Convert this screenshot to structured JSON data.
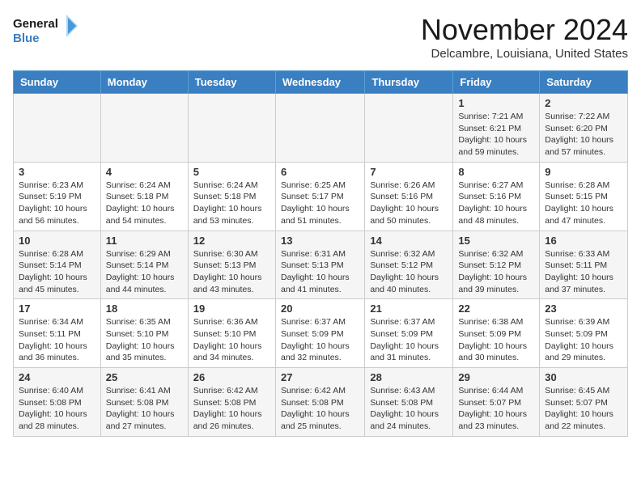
{
  "logo": {
    "line1": "General",
    "line2": "Blue"
  },
  "title": "November 2024",
  "location": "Delcambre, Louisiana, United States",
  "weekdays": [
    "Sunday",
    "Monday",
    "Tuesday",
    "Wednesday",
    "Thursday",
    "Friday",
    "Saturday"
  ],
  "weeks": [
    [
      {
        "day": "",
        "info": ""
      },
      {
        "day": "",
        "info": ""
      },
      {
        "day": "",
        "info": ""
      },
      {
        "day": "",
        "info": ""
      },
      {
        "day": "",
        "info": ""
      },
      {
        "day": "1",
        "info": "Sunrise: 7:21 AM\nSunset: 6:21 PM\nDaylight: 10 hours\nand 59 minutes."
      },
      {
        "day": "2",
        "info": "Sunrise: 7:22 AM\nSunset: 6:20 PM\nDaylight: 10 hours\nand 57 minutes."
      }
    ],
    [
      {
        "day": "3",
        "info": "Sunrise: 6:23 AM\nSunset: 5:19 PM\nDaylight: 10 hours\nand 56 minutes."
      },
      {
        "day": "4",
        "info": "Sunrise: 6:24 AM\nSunset: 5:18 PM\nDaylight: 10 hours\nand 54 minutes."
      },
      {
        "day": "5",
        "info": "Sunrise: 6:24 AM\nSunset: 5:18 PM\nDaylight: 10 hours\nand 53 minutes."
      },
      {
        "day": "6",
        "info": "Sunrise: 6:25 AM\nSunset: 5:17 PM\nDaylight: 10 hours\nand 51 minutes."
      },
      {
        "day": "7",
        "info": "Sunrise: 6:26 AM\nSunset: 5:16 PM\nDaylight: 10 hours\nand 50 minutes."
      },
      {
        "day": "8",
        "info": "Sunrise: 6:27 AM\nSunset: 5:16 PM\nDaylight: 10 hours\nand 48 minutes."
      },
      {
        "day": "9",
        "info": "Sunrise: 6:28 AM\nSunset: 5:15 PM\nDaylight: 10 hours\nand 47 minutes."
      }
    ],
    [
      {
        "day": "10",
        "info": "Sunrise: 6:28 AM\nSunset: 5:14 PM\nDaylight: 10 hours\nand 45 minutes."
      },
      {
        "day": "11",
        "info": "Sunrise: 6:29 AM\nSunset: 5:14 PM\nDaylight: 10 hours\nand 44 minutes."
      },
      {
        "day": "12",
        "info": "Sunrise: 6:30 AM\nSunset: 5:13 PM\nDaylight: 10 hours\nand 43 minutes."
      },
      {
        "day": "13",
        "info": "Sunrise: 6:31 AM\nSunset: 5:13 PM\nDaylight: 10 hours\nand 41 minutes."
      },
      {
        "day": "14",
        "info": "Sunrise: 6:32 AM\nSunset: 5:12 PM\nDaylight: 10 hours\nand 40 minutes."
      },
      {
        "day": "15",
        "info": "Sunrise: 6:32 AM\nSunset: 5:12 PM\nDaylight: 10 hours\nand 39 minutes."
      },
      {
        "day": "16",
        "info": "Sunrise: 6:33 AM\nSunset: 5:11 PM\nDaylight: 10 hours\nand 37 minutes."
      }
    ],
    [
      {
        "day": "17",
        "info": "Sunrise: 6:34 AM\nSunset: 5:11 PM\nDaylight: 10 hours\nand 36 minutes."
      },
      {
        "day": "18",
        "info": "Sunrise: 6:35 AM\nSunset: 5:10 PM\nDaylight: 10 hours\nand 35 minutes."
      },
      {
        "day": "19",
        "info": "Sunrise: 6:36 AM\nSunset: 5:10 PM\nDaylight: 10 hours\nand 34 minutes."
      },
      {
        "day": "20",
        "info": "Sunrise: 6:37 AM\nSunset: 5:09 PM\nDaylight: 10 hours\nand 32 minutes."
      },
      {
        "day": "21",
        "info": "Sunrise: 6:37 AM\nSunset: 5:09 PM\nDaylight: 10 hours\nand 31 minutes."
      },
      {
        "day": "22",
        "info": "Sunrise: 6:38 AM\nSunset: 5:09 PM\nDaylight: 10 hours\nand 30 minutes."
      },
      {
        "day": "23",
        "info": "Sunrise: 6:39 AM\nSunset: 5:09 PM\nDaylight: 10 hours\nand 29 minutes."
      }
    ],
    [
      {
        "day": "24",
        "info": "Sunrise: 6:40 AM\nSunset: 5:08 PM\nDaylight: 10 hours\nand 28 minutes."
      },
      {
        "day": "25",
        "info": "Sunrise: 6:41 AM\nSunset: 5:08 PM\nDaylight: 10 hours\nand 27 minutes."
      },
      {
        "day": "26",
        "info": "Sunrise: 6:42 AM\nSunset: 5:08 PM\nDaylight: 10 hours\nand 26 minutes."
      },
      {
        "day": "27",
        "info": "Sunrise: 6:42 AM\nSunset: 5:08 PM\nDaylight: 10 hours\nand 25 minutes."
      },
      {
        "day": "28",
        "info": "Sunrise: 6:43 AM\nSunset: 5:08 PM\nDaylight: 10 hours\nand 24 minutes."
      },
      {
        "day": "29",
        "info": "Sunrise: 6:44 AM\nSunset: 5:07 PM\nDaylight: 10 hours\nand 23 minutes."
      },
      {
        "day": "30",
        "info": "Sunrise: 6:45 AM\nSunset: 5:07 PM\nDaylight: 10 hours\nand 22 minutes."
      }
    ]
  ]
}
